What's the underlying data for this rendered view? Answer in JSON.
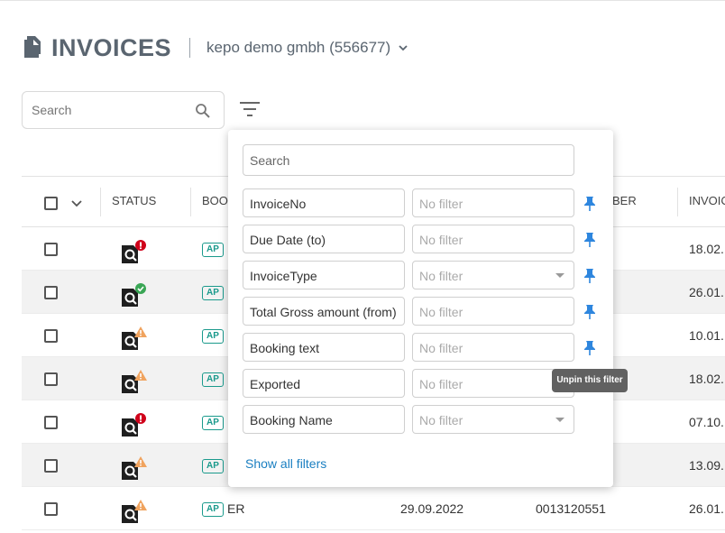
{
  "header": {
    "title": "INVOICES",
    "company": "kepo demo gmbh (556677)"
  },
  "search": {
    "placeholder": "Search"
  },
  "table": {
    "columns": [
      "STATUS",
      "BOO",
      "BER",
      "INVOIC"
    ],
    "rows": [
      {
        "status": "error",
        "type": "AP",
        "col5": "18.02.",
        "shaded": false
      },
      {
        "status": "ok",
        "type": "AP",
        "col5": "26.01.",
        "shaded": true
      },
      {
        "status": "warning",
        "type": "AP",
        "col5": "10.01.",
        "shaded": false
      },
      {
        "status": "warning",
        "type": "AP",
        "col5": "18.02.",
        "shaded": true
      },
      {
        "status": "error",
        "type": "AP",
        "col5": "07.10.",
        "shaded": false
      },
      {
        "status": "warning",
        "type": "AP",
        "col5": "13.09.",
        "shaded": true
      },
      {
        "status": "warning",
        "type": "AP",
        "booking": "ER",
        "date": "29.09.2022",
        "number": "0013120551",
        "col5": "26.01.",
        "shaded": false
      }
    ]
  },
  "filter_popup": {
    "search_placeholder": "Search",
    "filters": [
      {
        "name": "InvoiceNo",
        "value": "No filter",
        "dropdown": false,
        "pinned": true
      },
      {
        "name": "Due Date (to)",
        "value": "No filter",
        "dropdown": false,
        "pinned": true
      },
      {
        "name": "InvoiceType",
        "value": "No filter",
        "dropdown": true,
        "pinned": true
      },
      {
        "name": "Total Gross amount (from)",
        "value": "No filter",
        "dropdown": false,
        "pinned": true
      },
      {
        "name": "Booking text",
        "value": "No filter",
        "dropdown": false,
        "pinned": true
      },
      {
        "name": "Exported",
        "value": "No filter",
        "dropdown": false,
        "pinned": false
      },
      {
        "name": "Booking Name",
        "value": "No filter",
        "dropdown": true,
        "pinned": false
      }
    ],
    "show_all_label": "Show all filters",
    "tooltip": "Unpin this filter"
  },
  "colors": {
    "accent": "#1a7fc1",
    "pin": "#2e86de",
    "ap_badge": "#1a9a8c",
    "error": "#d0021b",
    "ok": "#3aa655",
    "warning": "#f0a35e"
  }
}
